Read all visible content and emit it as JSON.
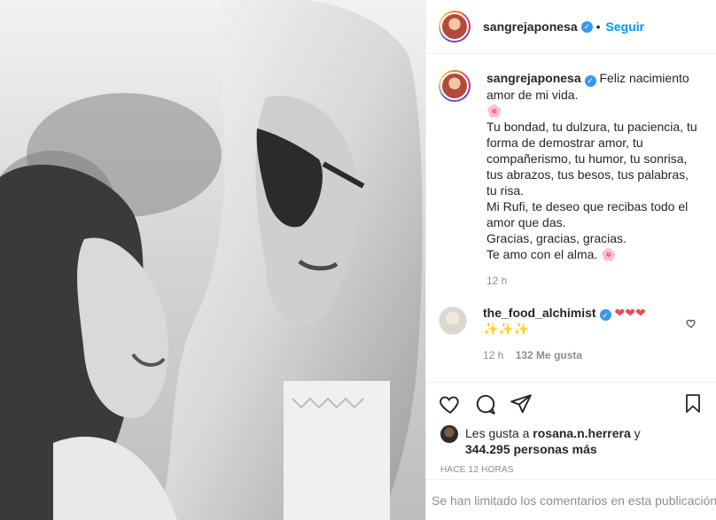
{
  "post": {
    "author": {
      "username": "sangrejaponesa",
      "verified_icon": "verified-badge-icon",
      "follow_label": "Seguir"
    },
    "caption": {
      "lines": [
        "Feliz nacimiento amor de mi vida.",
        "🌸",
        "Tu bondad, tu dulzura, tu paciencia, tu forma de demostrar amor, tu compañerismo, tu humor, tu sonrisa, tus abrazos, tus besos, tus palabras, tu risa.",
        "Mi Rufi, te deseo que recibas todo el amor que das.",
        "Gracias, gracias, gracias.",
        "Te amo con el alma. 🌸"
      ],
      "time": "12 h"
    },
    "comment": {
      "username": "the_food_alchimist",
      "hearts": "❤❤❤",
      "sparkles": "✨✨✨",
      "time": "12 h",
      "likes": "132 Me gusta"
    },
    "likes_line": {
      "prefix": "Les gusta a",
      "user": "rosana.n.herrera",
      "joiner": "y",
      "others": "344.295 personas más"
    },
    "time_ago": "HACE 12 HORAS",
    "comments_limited": "Se han limitado los comentarios en esta publicación."
  },
  "colors": {
    "link_blue": "#0095f6",
    "verified_blue": "#3897f0",
    "secondary_text": "#8e8e8e",
    "heart_red": "#ed4956"
  },
  "icons": [
    "heart-icon",
    "comment-icon",
    "share-icon",
    "bookmark-icon",
    "like-comment-icon"
  ]
}
